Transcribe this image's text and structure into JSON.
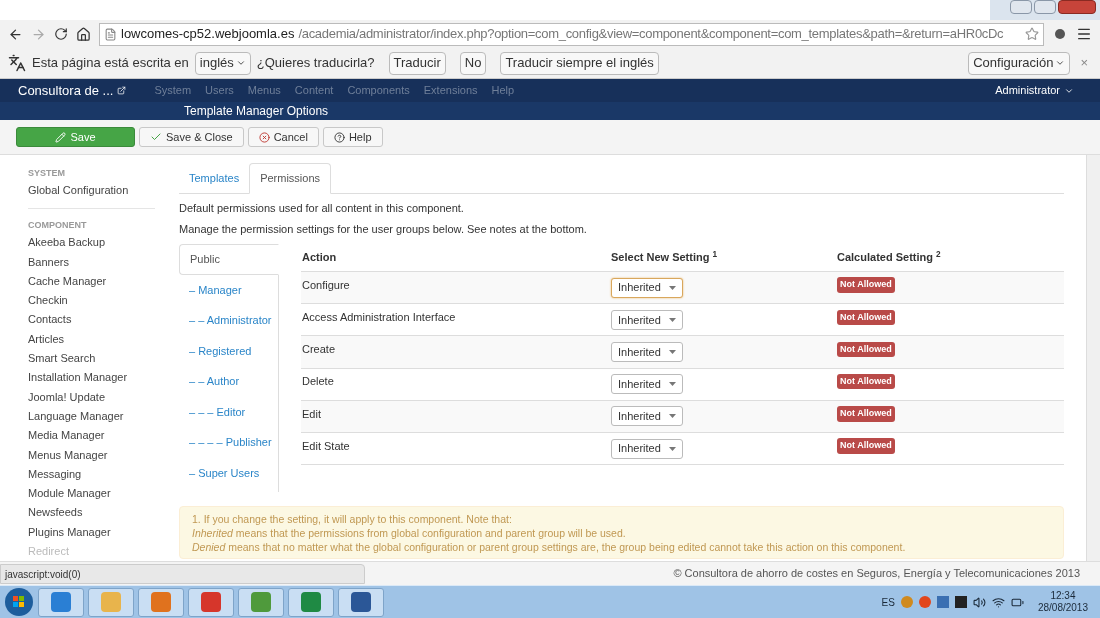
{
  "browser": {
    "url_host": "lowcomes-cp52.webjoomla.es",
    "url_path": "/academia/administrator/index.php?option=com_config&view=component&component=com_templates&path=&return=aHR0cDc"
  },
  "translate_bar": {
    "prompt": "Esta página está escrita en",
    "language": "inglés",
    "question": "¿Quieres traducirla?",
    "buttons": [
      "Traducir",
      "No",
      "Traducir siempre el inglés"
    ],
    "settings": "Configuración",
    "close": "×"
  },
  "navbar": {
    "site": "Consultora de ...",
    "menu": [
      "System",
      "Users",
      "Menus",
      "Content",
      "Components",
      "Extensions",
      "Help"
    ],
    "user": "Administrator"
  },
  "header": {
    "title": "Template Manager Options"
  },
  "toolbar": [
    {
      "kind": "primary",
      "label": "Save"
    },
    {
      "kind": "default",
      "label": "Save & Close"
    },
    {
      "kind": "cancel",
      "label": "Cancel"
    },
    {
      "kind": "help",
      "label": "Help"
    }
  ],
  "sidebar": [
    {
      "heading": "SYSTEM",
      "items": [
        {
          "label": "Global Configuration",
          "disabled": false
        }
      ]
    },
    {
      "heading": "COMPONENT",
      "items": [
        {
          "label": "Akeeba Backup",
          "disabled": false
        },
        {
          "label": "Banners",
          "disabled": false
        },
        {
          "label": "Cache Manager",
          "disabled": false
        },
        {
          "label": "Checkin",
          "disabled": false
        },
        {
          "label": "Contacts",
          "disabled": false
        },
        {
          "label": "Articles",
          "disabled": false
        },
        {
          "label": "Smart Search",
          "disabled": false
        },
        {
          "label": "Installation Manager",
          "disabled": false
        },
        {
          "label": "Joomla! Update",
          "disabled": false
        },
        {
          "label": "Language Manager",
          "disabled": false
        },
        {
          "label": "Media Manager",
          "disabled": false
        },
        {
          "label": "Menus Manager",
          "disabled": false
        },
        {
          "label": "Messaging",
          "disabled": false
        },
        {
          "label": "Module Manager",
          "disabled": false
        },
        {
          "label": "Newsfeeds",
          "disabled": false
        },
        {
          "label": "Plugins Manager",
          "disabled": false
        },
        {
          "label": "Redirect",
          "disabled": true
        }
      ]
    }
  ],
  "tabs": [
    {
      "label": "Templates",
      "selected": false
    },
    {
      "label": "Permissions",
      "selected": true
    }
  ],
  "intro": [
    "Default permissions used for all content in this component.",
    "Manage the permission settings for the user groups below. See notes at the bottom."
  ],
  "groups": [
    {
      "label": "Public",
      "selected": true
    },
    {
      "label": "– Manager",
      "selected": false
    },
    {
      "label": "– – Administrator",
      "selected": false
    },
    {
      "label": "– Registered",
      "selected": false
    },
    {
      "label": "– – Author",
      "selected": false
    },
    {
      "label": "– – – Editor",
      "selected": false
    },
    {
      "label": "– – – – Publisher",
      "selected": false
    },
    {
      "label": "– Super Users",
      "selected": false
    }
  ],
  "table": {
    "columns": [
      "Action",
      "Select New Setting $^{1}$",
      "Calculated Setting $^{2}$"
    ],
    "rows": [
      {
        "action": "Configure",
        "setting": "Inherited",
        "focused": true,
        "calculated": "Not Allowed"
      },
      {
        "action": "Access Administration Interface",
        "setting": "Inherited",
        "focused": false,
        "calculated": "Not Allowed"
      },
      {
        "action": "Create",
        "setting": "Inherited",
        "focused": false,
        "calculated": "Not Allowed"
      },
      {
        "action": "Delete",
        "setting": "Inherited",
        "focused": false,
        "calculated": "Not Allowed"
      },
      {
        "action": "Edit",
        "setting": "Inherited",
        "focused": false,
        "calculated": "Not Allowed"
      },
      {
        "action": "Edit State",
        "setting": "Inherited",
        "focused": false,
        "calculated": "Not Allowed"
      }
    ]
  },
  "notes": [
    "1. If you change the setting, it will apply to this component. Note that:",
    "*Inherited* means that the permissions from global configuration and parent group will be used.",
    "*Denied* means that no matter what the global configuration or parent group settings are, the group being edited cannot take this action on this component."
  ],
  "status_url": "javascript:void(0)",
  "footer": "© Consultora de ahorro de costes en Seguros, Energía y Telecomunicaciones 2013",
  "taskbar": {
    "language": "ES",
    "time": "12:34",
    "date": "28/08/2013"
  }
}
